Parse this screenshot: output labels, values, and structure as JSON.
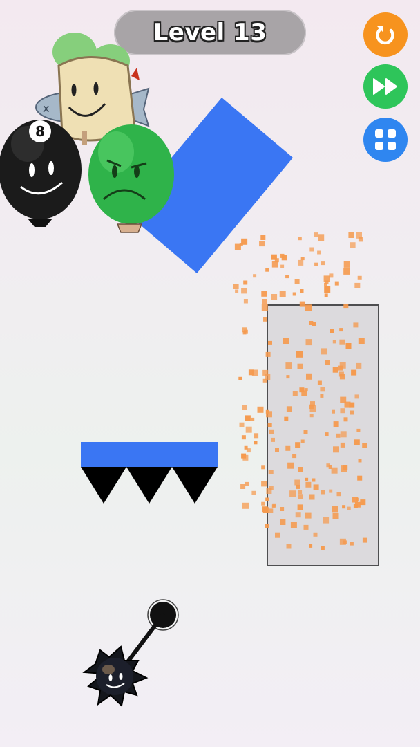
{
  "hud": {
    "level_label": "Level 13"
  },
  "controls": [
    {
      "name": "restart-button",
      "icon": "restart-icon",
      "color": "#f7931e"
    },
    {
      "name": "skip-button",
      "icon": "fast-forward-icon",
      "color": "#2ec55a"
    },
    {
      "name": "level-menu-button",
      "icon": "grid-icon",
      "color": "#2f86f0"
    }
  ],
  "scene": {
    "characters": [
      "8-ball-balloon-character",
      "green-balloon-character",
      "bread-character",
      "fish-character"
    ],
    "colors": {
      "block_blue": "#3a76f3",
      "particle_orange": "#f59a4e",
      "spike_black": "#000000",
      "glass": "#dcdadd"
    }
  }
}
